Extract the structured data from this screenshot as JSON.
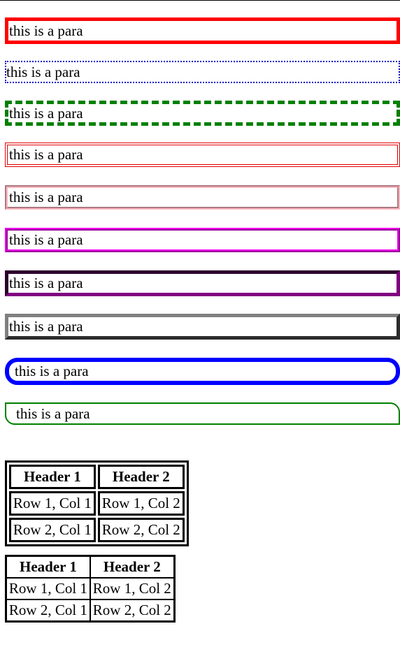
{
  "paragraphs": [
    {
      "text": "this is a para",
      "style": "solid-red-thick"
    },
    {
      "text": "this is a para",
      "style": "dotted-blue"
    },
    {
      "text": "this is a para",
      "style": "dashed-green"
    },
    {
      "text": "this is a para",
      "style": "double-red"
    },
    {
      "text": "this is a para",
      "style": "groove-pink"
    },
    {
      "text": "this is a para",
      "style": "ridge-violet"
    },
    {
      "text": "this is a para",
      "style": "inset-purple"
    },
    {
      "text": "this is a para",
      "style": "outset-grey"
    },
    {
      "text": "this is a para",
      "style": "rounded-blue"
    },
    {
      "text": "this is a para",
      "style": "corner-rounded-green"
    }
  ],
  "table_separate": {
    "headers": [
      "Header 1",
      "Header 2"
    ],
    "rows": [
      [
        "Row 1, Col 1",
        "Row 1, Col 2"
      ],
      [
        "Row 2, Col 1",
        "Row 2, Col 2"
      ]
    ]
  },
  "table_collapsed": {
    "headers": [
      "Header 1",
      "Header 2"
    ],
    "rows": [
      [
        "Row 1, Col 1",
        "Row 1, Col 2"
      ],
      [
        "Row 2, Col 1",
        "Row 2, Col 2"
      ]
    ]
  },
  "colors": {
    "red": "#ff0000",
    "blue": "#0000ff",
    "green": "#008000",
    "pink": "#ffb6c1",
    "violet": "#ee00ee",
    "purple": "#800080",
    "grey": "#808080"
  }
}
